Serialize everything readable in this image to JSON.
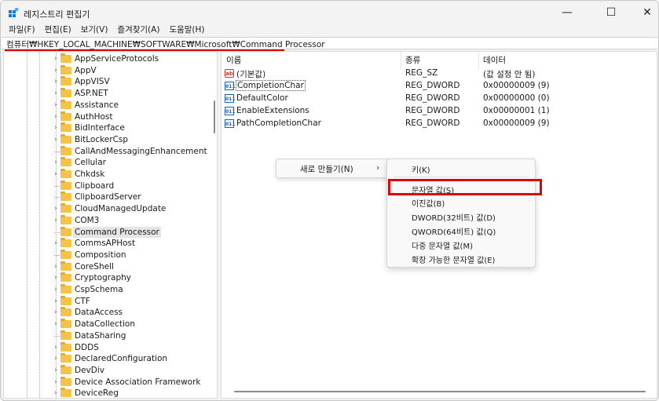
{
  "window": {
    "title": "레지스트리 편집기",
    "controls": {
      "minimize": "—",
      "maximize": "☐",
      "close": "✕"
    }
  },
  "menu": [
    "파일(F)",
    "편집(E)",
    "보기(V)",
    "즐겨찾기(A)",
    "도움말(H)"
  ],
  "address": "컴퓨터₩HKEY_LOCAL_MACHINE₩SOFTWARE₩Microsoft₩Command Processor",
  "tree": {
    "selected": "Command Processor",
    "items": [
      {
        "label": "AppServiceProtocols",
        "expandable": true
      },
      {
        "label": "AppV",
        "expandable": true
      },
      {
        "label": "AppVISV",
        "expandable": true
      },
      {
        "label": "ASP.NET",
        "expandable": true
      },
      {
        "label": "Assistance",
        "expandable": true
      },
      {
        "label": "AuthHost",
        "expandable": true
      },
      {
        "label": "BidInterface",
        "expandable": true
      },
      {
        "label": "BitLockerCsp",
        "expandable": true
      },
      {
        "label": "CallAndMessagingEnhancement",
        "expandable": false
      },
      {
        "label": "Cellular",
        "expandable": true
      },
      {
        "label": "Chkdsk",
        "expandable": true
      },
      {
        "label": "Clipboard",
        "expandable": false
      },
      {
        "label": "ClipboardServer",
        "expandable": false
      },
      {
        "label": "CloudManagedUpdate",
        "expandable": true
      },
      {
        "label": "COM3",
        "expandable": true
      },
      {
        "label": "Command Processor",
        "expandable": false
      },
      {
        "label": "CommsAPHost",
        "expandable": true
      },
      {
        "label": "Composition",
        "expandable": false
      },
      {
        "label": "CoreShell",
        "expandable": true
      },
      {
        "label": "Cryptography",
        "expandable": true
      },
      {
        "label": "CspSchema",
        "expandable": true
      },
      {
        "label": "CTF",
        "expandable": true
      },
      {
        "label": "DataAccess",
        "expandable": true
      },
      {
        "label": "DataCollection",
        "expandable": true
      },
      {
        "label": "DataSharing",
        "expandable": false
      },
      {
        "label": "DDDS",
        "expandable": true
      },
      {
        "label": "DeclaredConfiguration",
        "expandable": true
      },
      {
        "label": "DevDiv",
        "expandable": true
      },
      {
        "label": "Device Association Framework",
        "expandable": true
      },
      {
        "label": "DeviceReg",
        "expandable": true
      }
    ]
  },
  "list": {
    "columns": [
      "이름",
      "종류",
      "데이터"
    ],
    "rows": [
      {
        "icon": "ab",
        "name": "(기본값)",
        "type": "REG_SZ",
        "data": "(값 설정 안 됨)"
      },
      {
        "icon": "bin",
        "name": "CompletionChar",
        "type": "REG_DWORD",
        "data": "0x00000009 (9)"
      },
      {
        "icon": "bin",
        "name": "DefaultColor",
        "type": "REG_DWORD",
        "data": "0x00000000 (0)"
      },
      {
        "icon": "bin",
        "name": "EnableExtensions",
        "type": "REG_DWORD",
        "data": "0x00000001 (1)"
      },
      {
        "icon": "bin",
        "name": "PathCompletionChar",
        "type": "REG_DWORD",
        "data": "0x00000009 (9)"
      }
    ]
  },
  "context_menu": {
    "new": "새로 만들기(N)",
    "arrow": "›",
    "submenu": [
      "키(K)",
      "문자열 값(S)",
      "이진값(B)",
      "DWORD(32비트) 값(D)",
      "QWORD(64비트) 값(Q)",
      "다중 문자열 값(M)",
      "확장 가능한 문자열 값(E)"
    ],
    "highlighted": "문자열 값(S)"
  },
  "colors": {
    "annotation": "#e00000",
    "folder": "#f5c24a"
  }
}
